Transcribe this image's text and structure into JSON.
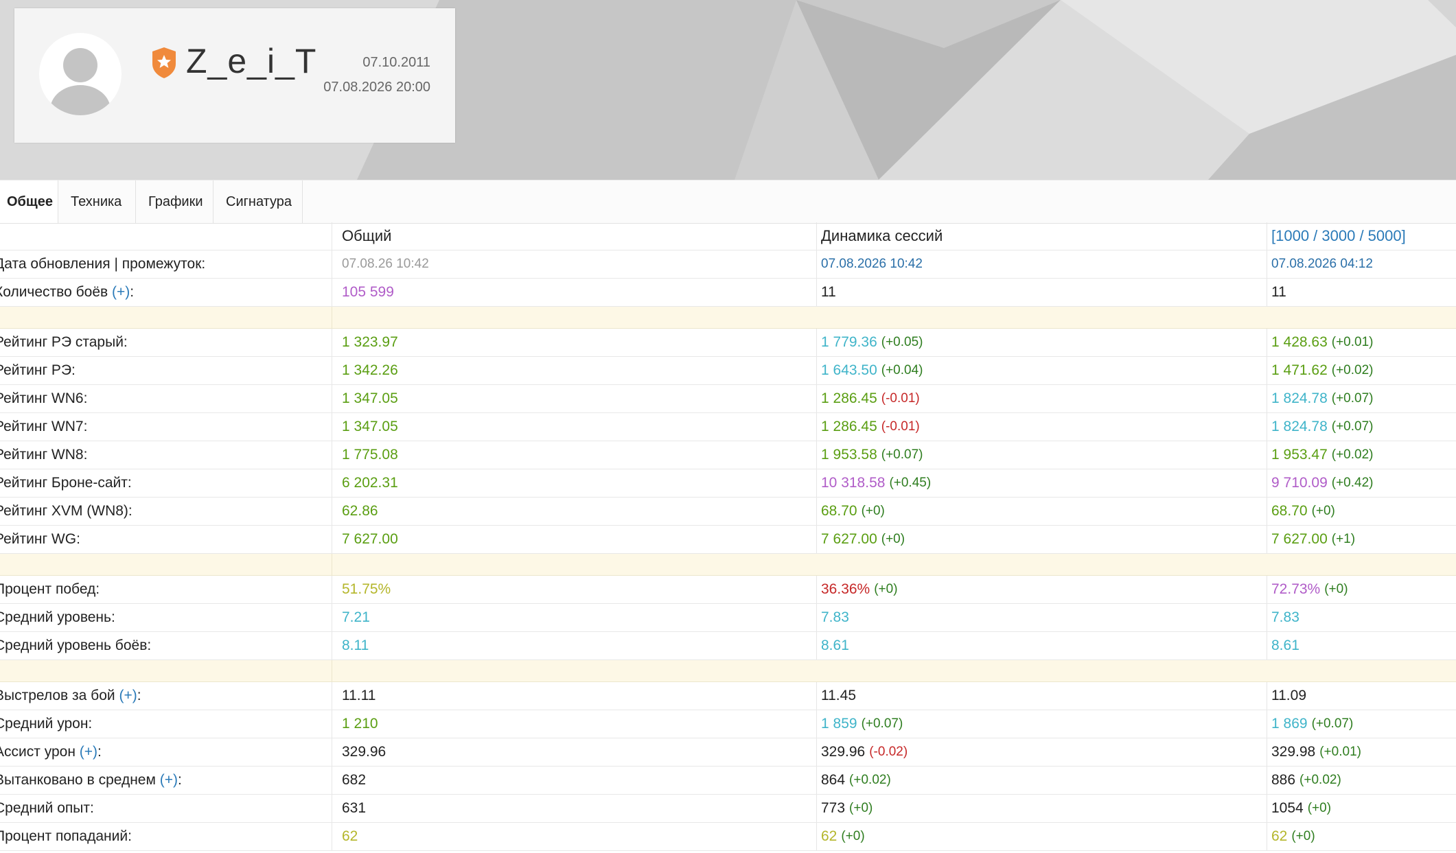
{
  "profile": {
    "username": "Z_e_i_T",
    "registered": "07.10.2011",
    "last_seen": "07.08.2026 20:00",
    "badge_color": "#f08a3c"
  },
  "tabs": [
    "Общее",
    "Техника",
    "Графики",
    "Сигнатура"
  ],
  "active_tab": "Общее",
  "columns": {
    "general": "Общий",
    "sessions": "Динамика сессий",
    "range": "[1000 / 3000 / 5000]"
  },
  "rows": {
    "update": {
      "label": "Дата обновления | промежуток:",
      "v1": "07.08.26 10:42",
      "v2": "07.08.2026 10:42",
      "v3": "07.08.2026 04:12"
    },
    "battles": {
      "label": "Количество боёв",
      "plus": "(+)",
      "colon": ":",
      "v1": "105 599",
      "v2": "11",
      "v3": "11"
    },
    "re_old": {
      "label": "Рейтинг РЭ старый:",
      "v1": "1 323.97",
      "v2": "1 779.36",
      "d2": "(+0.05)",
      "v3": "1 428.63",
      "d3": "(+0.01)"
    },
    "re": {
      "label": "Рейтинг РЭ:",
      "v1": "1 342.26",
      "v2": "1 643.50",
      "d2": "(+0.04)",
      "v3": "1 471.62",
      "d3": "(+0.02)"
    },
    "wn6": {
      "label": "Рейтинг WN6:",
      "v1": "1 347.05",
      "v2": "1 286.45",
      "d2": "(-0.01)",
      "v3": "1 824.78",
      "d3": "(+0.07)"
    },
    "wn7": {
      "label": "Рейтинг WN7:",
      "v1": "1 347.05",
      "v2": "1 286.45",
      "d2": "(-0.01)",
      "v3": "1 824.78",
      "d3": "(+0.07)"
    },
    "wn8": {
      "label": "Рейтинг WN8:",
      "v1": "1 775.08",
      "v2": "1 953.58",
      "d2": "(+0.07)",
      "v3": "1 953.47",
      "d3": "(+0.02)"
    },
    "brone": {
      "label": "Рейтинг Броне-сайт:",
      "v1": "6 202.31",
      "v2": "10 318.58",
      "d2": "(+0.45)",
      "v3": "9 710.09",
      "d3": "(+0.42)"
    },
    "xvm": {
      "label": "Рейтинг XVM (WN8):",
      "v1": "62.86",
      "v2": "68.70",
      "d2": "(+0)",
      "v3": "68.70",
      "d3": "(+0)"
    },
    "wg": {
      "label": "Рейтинг WG:",
      "v1": "7 627.00",
      "v2": "7 627.00",
      "d2": "(+0)",
      "v3": "7 627.00",
      "d3": "(+1)"
    },
    "wins": {
      "label": "Процент побед:",
      "v1": "51.75%",
      "v2": "36.36%",
      "d2": "(+0)",
      "v3": "72.73%",
      "d3": "(+0)"
    },
    "avg_tier": {
      "label": "Средний уровень:",
      "v1": "7.21",
      "v2": "7.83",
      "v3": "7.83"
    },
    "avg_battle_tier": {
      "label": "Средний уровень боёв:",
      "v1": "8.11",
      "v2": "8.61",
      "v3": "8.61"
    },
    "shots": {
      "label": "Выстрелов за бой",
      "plus": "(+)",
      "colon": ":",
      "v1": "11.11",
      "v2": "11.45",
      "v3": "11.09"
    },
    "avg_dmg": {
      "label": "Средний урон:",
      "v1": "1 210",
      "v2": "1 859",
      "d2": "(+0.07)",
      "v3": "1 869",
      "d3": "(+0.07)"
    },
    "assist": {
      "label": "Ассист урон",
      "plus": "(+)",
      "colon": ":",
      "v1": "329.96",
      "v2": "329.96",
      "d2": "(-0.02)",
      "v3": "329.98",
      "d3": "(+0.01)"
    },
    "tanked": {
      "label": "Вытанковано в среднем",
      "plus": "(+)",
      "colon": ":",
      "v1": "682",
      "v2": "864",
      "d2": "(+0.02)",
      "v3": "886",
      "d3": "(+0.02)"
    },
    "avg_xp": {
      "label": "Средний опыт:",
      "v1": "631",
      "v2": "773",
      "d2": "(+0)",
      "v3": "1054",
      "d3": "(+0)"
    },
    "hit_pct": {
      "label": "Процент попаданий:",
      "v1": "62",
      "v2": "62",
      "d2": "(+0)",
      "v3": "62",
      "d3": "(+0)"
    }
  }
}
